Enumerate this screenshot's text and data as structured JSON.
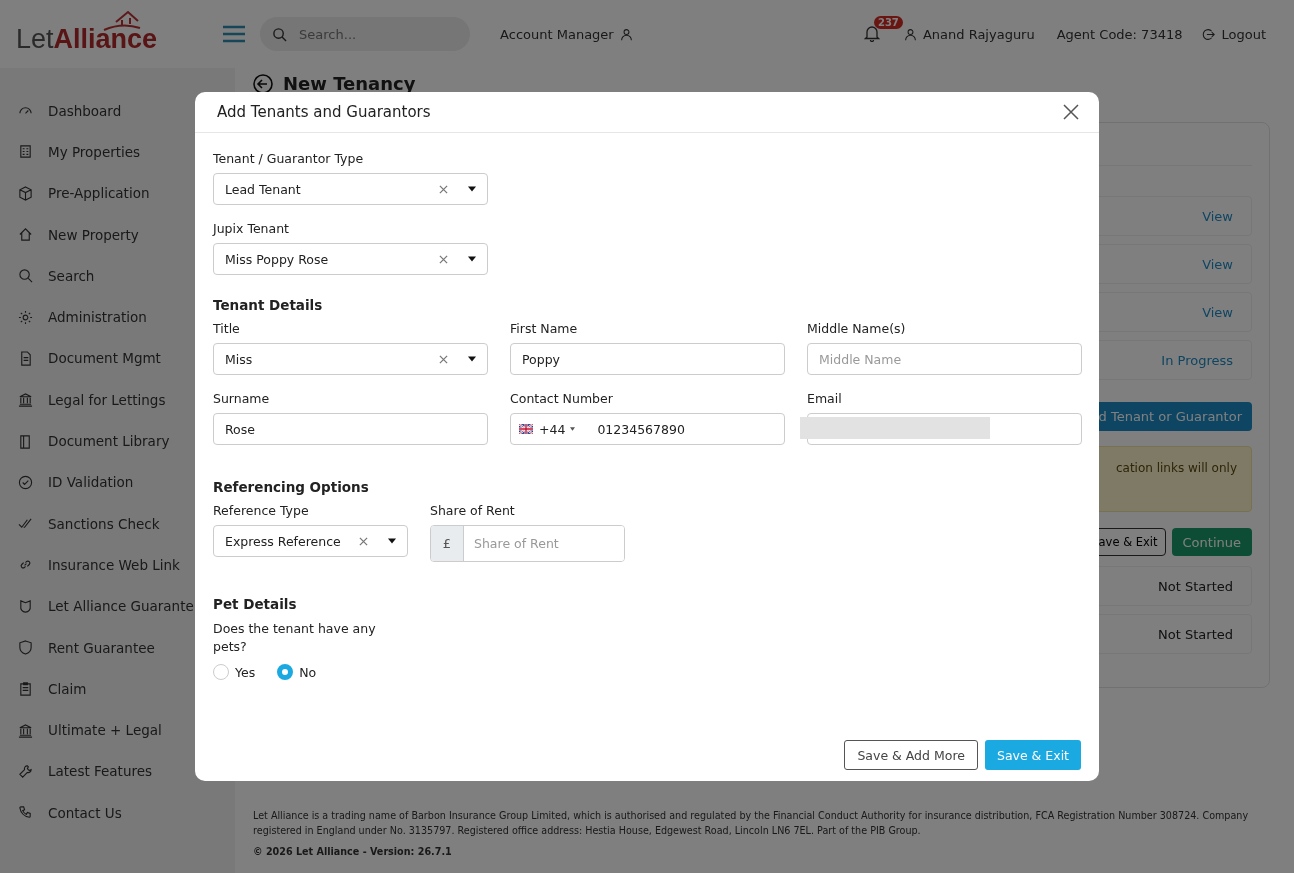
{
  "logo": {
    "text_light": "Let",
    "text_bold": "Alliance"
  },
  "header": {
    "search": {
      "placeholder": "Search..."
    },
    "account_manager": "Account Manager",
    "notifications": {
      "count": "237"
    },
    "user": "Anand Rajyaguru",
    "agent_code": "Agent Code: 73418",
    "logout": "Logout"
  },
  "sidebar": {
    "items": [
      {
        "label": "Dashboard"
      },
      {
        "label": "My Properties"
      },
      {
        "label": "Pre-Application"
      },
      {
        "label": "New Property"
      },
      {
        "label": "Search"
      },
      {
        "label": "Administration"
      },
      {
        "label": "Document Mgmt"
      },
      {
        "label": "Legal for Lettings"
      },
      {
        "label": "Document Library"
      },
      {
        "label": "ID Validation"
      },
      {
        "label": "Sanctions Check"
      },
      {
        "label": "Insurance Web Link"
      },
      {
        "label": "Let Alliance Guarante"
      },
      {
        "label": "Rent Guarantee"
      },
      {
        "label": "Claim"
      },
      {
        "label": "Ultimate + Legal"
      },
      {
        "label": "Latest Features"
      },
      {
        "label": "Contact Us"
      }
    ]
  },
  "page": {
    "title": "New Tenancy",
    "status_rows": [
      {
        "text": "View"
      },
      {
        "text": "View"
      },
      {
        "text": "View"
      },
      {
        "text": "In Progress"
      }
    ],
    "add_button": "d Tenant or Guarantor",
    "notice": "cation links will only",
    "save_exit_button": "ave & Exit",
    "continue_button": "Continue",
    "lower_rows": [
      {
        "text": "Not Started"
      },
      {
        "text": "Not Started"
      }
    ]
  },
  "footer": {
    "legal": "Let Alliance is a trading name of Barbon Insurance Group Limited, which is authorised and regulated by the Financial Conduct Authority for insurance distribution, FCA Registration Number 308724. Company registered in England under No. 3135797. Registered office address: Hestia House, Edgewest Road, Lincoln LN6 7EL. Part of the PIB Group.",
    "version": "© 2026 Let Alliance - Version: 26.7.1"
  },
  "modal": {
    "title": "Add Tenants and Guarantors",
    "type_field": {
      "label": "Tenant / Guarantor Type",
      "value": "Lead Tenant"
    },
    "jupix_field": {
      "label": "Jupix Tenant",
      "value": "Miss Poppy Rose"
    },
    "tenant_details": {
      "heading": "Tenant Details",
      "fields": [
        {
          "label": "Title",
          "kind": "select",
          "value": "Miss"
        },
        {
          "label": "First Name",
          "kind": "text",
          "value": "Poppy"
        },
        {
          "label": "Middle Name(s)",
          "kind": "text",
          "placeholder": "Middle Name"
        },
        {
          "label": "Surname",
          "kind": "text",
          "value": "Rose"
        },
        {
          "label": "Contact Number",
          "kind": "phone",
          "dial_code": "+44",
          "value": "01234567890"
        },
        {
          "label": "Email",
          "kind": "redacted"
        }
      ]
    },
    "referencing": {
      "heading": "Referencing Options",
      "reference_type": {
        "label": "Reference Type",
        "value": "Express Reference"
      },
      "share_of_rent": {
        "label": "Share of Rent",
        "currency": "£",
        "placeholder": "Share of Rent"
      }
    },
    "pets": {
      "heading": "Pet Details",
      "question": "Does the tenant have any pets?",
      "options": [
        {
          "label": "Yes",
          "selected": false
        },
        {
          "label": "No",
          "selected": true
        }
      ]
    },
    "buttons": {
      "save_add_more": "Save & Add More",
      "save_exit": "Save & Exit"
    }
  }
}
